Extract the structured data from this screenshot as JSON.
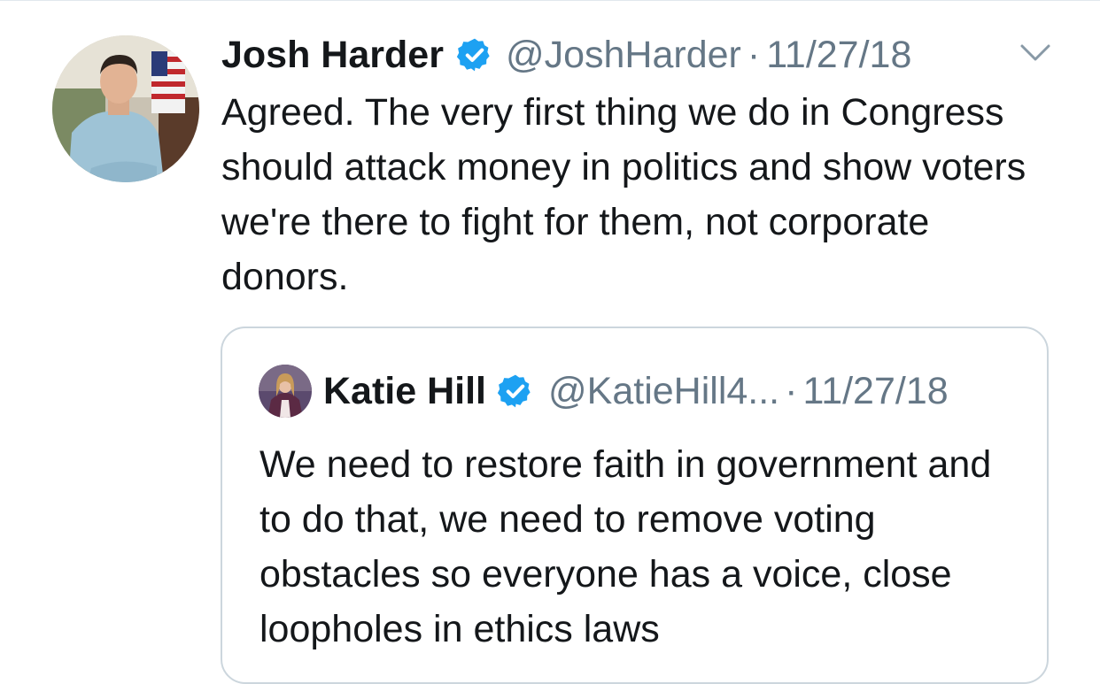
{
  "tweet": {
    "display_name": "Josh Harder",
    "handle": "@JoshHarder",
    "separator": "·",
    "date": "11/27/18",
    "text": "Agreed. The very first thing we do in Congress should attack money in politics and show voters we're there to fight for them, not corporate donors.",
    "verified": true,
    "avatar_icon": "profile-photo",
    "menu_icon": "chevron-down-icon"
  },
  "quoted_tweet": {
    "display_name": "Katie Hill",
    "handle": "@KatieHill4...",
    "separator": "·",
    "date": "11/27/18",
    "text": "We need to restore faith in government and to do that, we need to remove voting obstacles so everyone has a voice, close loopholes in ethics laws",
    "verified": true
  },
  "colors": {
    "text_primary": "#14171a",
    "text_secondary": "#657786",
    "verified_blue": "#1da1f2",
    "border": "#ccd6dd"
  }
}
